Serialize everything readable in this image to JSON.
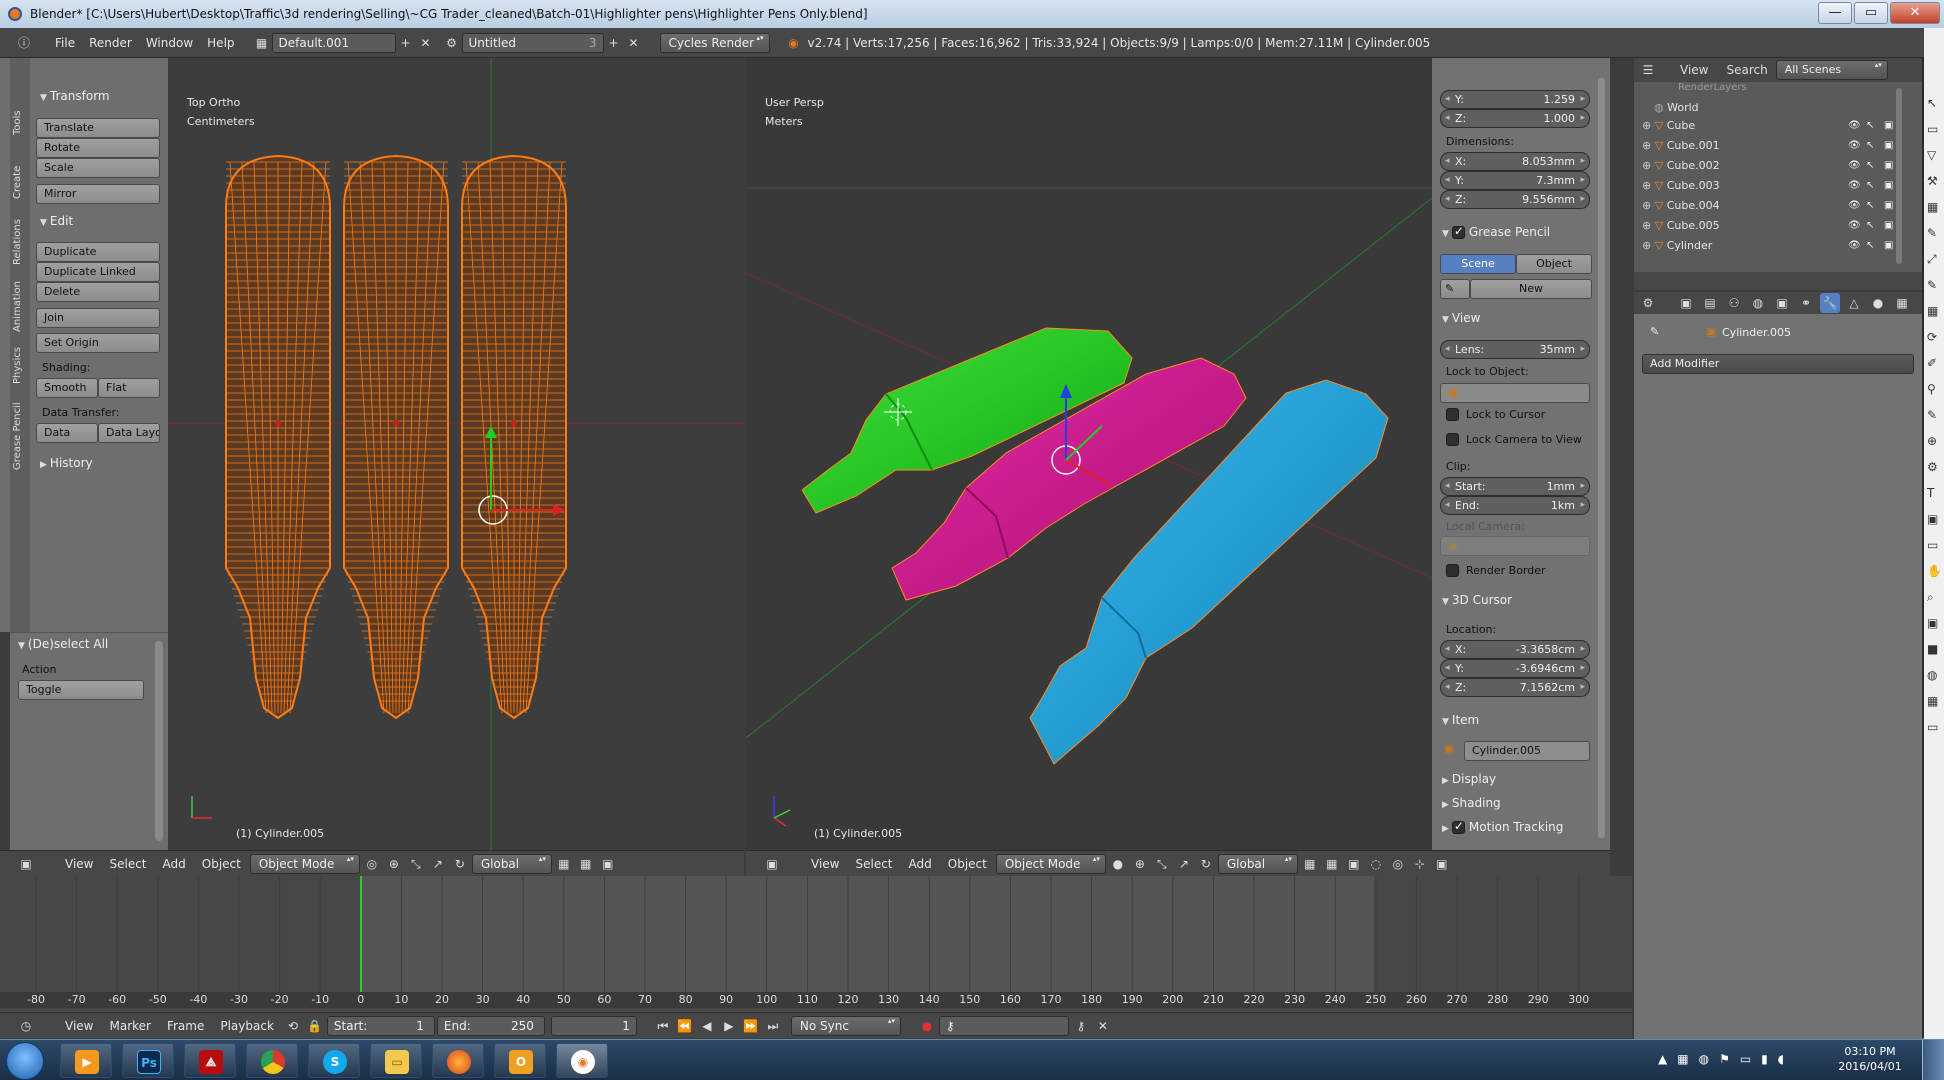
{
  "window": {
    "title": "Blender* [C:\\Users\\Hubert\\Desktop\\Traffic\\3d rendering\\Selling\\~CG Trader_cleaned\\Batch-01\\Highlighter pens\\Highlighter Pens Only.blend]",
    "controls": [
      "—",
      "▭",
      "✕"
    ]
  },
  "infobar": {
    "menu": [
      "File",
      "Render",
      "Window",
      "Help"
    ],
    "screen_layout": "Default.001",
    "scene": "Untitled",
    "scene_users": "3",
    "render_engine": "Cycles Render",
    "stats": "v2.74 | Verts:17,256 | Faces:16,962 | Tris:33,924 | Objects:9/9 | Lamps:0/0 | Mem:27.11M | Cylinder.005"
  },
  "toolshelf": {
    "tabs": [
      "Tools",
      "Create",
      "Relations",
      "Animation",
      "Physics",
      "Grease Pencil"
    ],
    "transform_header": "Transform",
    "transform": [
      "Translate",
      "Rotate",
      "Scale",
      "Mirror"
    ],
    "edit_header": "Edit",
    "edit": [
      "Duplicate",
      "Duplicate Linked",
      "Delete",
      "Join"
    ],
    "set_origin": "Set Origin",
    "shading_label": "Shading:",
    "shading": [
      "Smooth",
      "Flat"
    ],
    "data_transfer_label": "Data Transfer:",
    "data_transfer": [
      "Data",
      "Data Layo"
    ],
    "history_header": "History"
  },
  "operator_panel": {
    "header": "(De)select All",
    "action_label": "Action",
    "action_value": "Toggle"
  },
  "viewport_left": {
    "view_name": "Top Ortho",
    "units": "Centimeters",
    "object_label": "(1) Cylinder.005"
  },
  "viewport_right": {
    "view_name": "User Persp",
    "units": "Meters",
    "object_label": "(1) Cylinder.005"
  },
  "view3d_header": {
    "menus": [
      "View",
      "Select",
      "Add",
      "Object"
    ],
    "mode": "Object Mode",
    "orientation": "Global"
  },
  "properties_n": {
    "location_top": [
      {
        "k": "Y:",
        "v": "1.259"
      },
      {
        "k": "Z:",
        "v": "1.000"
      }
    ],
    "dimensions_label": "Dimensions:",
    "dimensions": [
      {
        "k": "X:",
        "v": "8.053mm"
      },
      {
        "k": "Y:",
        "v": "7.3mm"
      },
      {
        "k": "Z:",
        "v": "9.556mm"
      }
    ],
    "grease_pencil_header": "Grease Pencil",
    "gp_tabs": [
      "Scene",
      "Object"
    ],
    "gp_new": "New",
    "view_header": "View",
    "lens_label": "Lens:",
    "lens_value": "35mm",
    "lock_to_object_label": "Lock to Object:",
    "lock_to_cursor": "Lock to Cursor",
    "lock_camera_to_view": "Lock Camera to View",
    "clip_label": "Clip:",
    "clip_start": {
      "k": "Start:",
      "v": "1mm"
    },
    "clip_end": {
      "k": "End:",
      "v": "1km"
    },
    "local_camera_label": "Local Camera:",
    "render_border": "Render Border",
    "cursor_header": "3D Cursor",
    "cursor_location_label": "Location:",
    "cursor": [
      {
        "k": "X:",
        "v": "-3.3658cm"
      },
      {
        "k": "Y:",
        "v": "-3.6946cm"
      },
      {
        "k": "Z:",
        "v": "7.1562cm"
      }
    ],
    "item_header": "Item",
    "item_name": "Cylinder.005",
    "display_header": "Display",
    "shading_header": "Shading",
    "motion_tracking_header": "Motion Tracking"
  },
  "outliner": {
    "menus": [
      "View",
      "Search"
    ],
    "scene_filter": "All Scenes",
    "partial_top": "RenderLayers",
    "items": [
      "World",
      "Cube",
      "Cube.001",
      "Cube.002",
      "Cube.003",
      "Cube.004",
      "Cube.005",
      "Cylinder"
    ]
  },
  "properties_editor": {
    "object_name": "Cylinder.005",
    "add_modifier": "Add Modifier"
  },
  "timeline": {
    "ticks": [
      "-80",
      "-70",
      "-60",
      "-50",
      "-40",
      "-30",
      "-20",
      "-10",
      "0",
      "10",
      "20",
      "30",
      "40",
      "50",
      "60",
      "70",
      "80",
      "90",
      "100",
      "110",
      "120",
      "130",
      "140",
      "150",
      "160",
      "170",
      "180",
      "190",
      "200",
      "210",
      "220",
      "230",
      "240",
      "250",
      "260",
      "270",
      "280",
      "290",
      "300"
    ],
    "current_frame_marker": 0,
    "menus": [
      "View",
      "Marker",
      "Frame",
      "Playback"
    ],
    "start": {
      "k": "Start:",
      "v": "1"
    },
    "end": {
      "k": "End:",
      "v": "250"
    },
    "current": "1",
    "sync": "No Sync"
  },
  "taskbar": {
    "apps": [
      "start-orb",
      "media",
      "Ps",
      "pdf",
      "chrome",
      "S",
      "explorer",
      "firefox",
      "outlook",
      "blender"
    ],
    "time": "03:10 PM",
    "date": "2016/04/01"
  },
  "colors": {
    "green": "#1ec81a",
    "magenta": "#d0178e",
    "blue": "#1ba0d8",
    "wire": "#ff7a10",
    "panel": "#727272",
    "viewport": "#393939",
    "selected_tab": "#5680c2"
  }
}
